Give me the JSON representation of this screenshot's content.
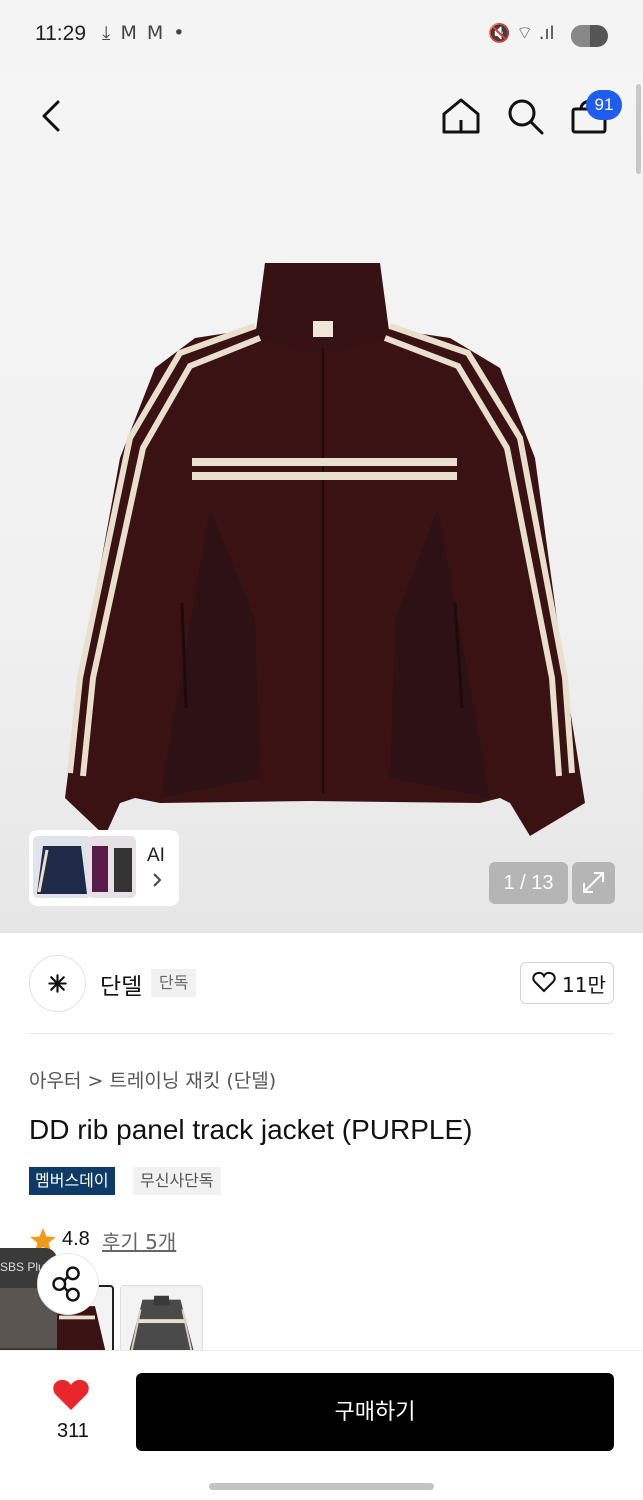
{
  "status_bar": {
    "time": "11:29",
    "left_icons": "⤓ M M •",
    "right_icons": "🔇 ⌔ .ıl"
  },
  "header": {
    "cart_count": "91"
  },
  "gallery": {
    "counter": "1 / 13",
    "ai_label": "AI"
  },
  "brand": {
    "name": "단델",
    "exclusive_tag": "단독",
    "likes": "11만"
  },
  "breadcrumb": {
    "category": "아우터",
    "separator": ">",
    "subcategory": "트레이닝 재킷 (단델)"
  },
  "product": {
    "title": "DD rib panel track jacket (PURPLE)",
    "badge_member": "멤버스데이",
    "badge_exclusive": "무신사단독",
    "rating": "4.8",
    "reviews": "후기 5개"
  },
  "pip": {
    "label": "SBS Plus"
  },
  "bottom_bar": {
    "wish_count": "311",
    "buy_label": "구매하기"
  },
  "colors": {
    "accent_blue": "#1f5cf0",
    "member_badge": "#0e3b66",
    "heart_red": "#e8262b",
    "star_orange": "#f39a1d",
    "jacket_body": "#3a1214",
    "jacket_stripe": "#e8e0cc"
  },
  "icons": [
    "back-chevron-icon",
    "home-icon",
    "search-icon",
    "cart-icon",
    "expand-icon",
    "heart-outline-icon",
    "star-icon",
    "share-icon",
    "heart-filled-icon"
  ]
}
